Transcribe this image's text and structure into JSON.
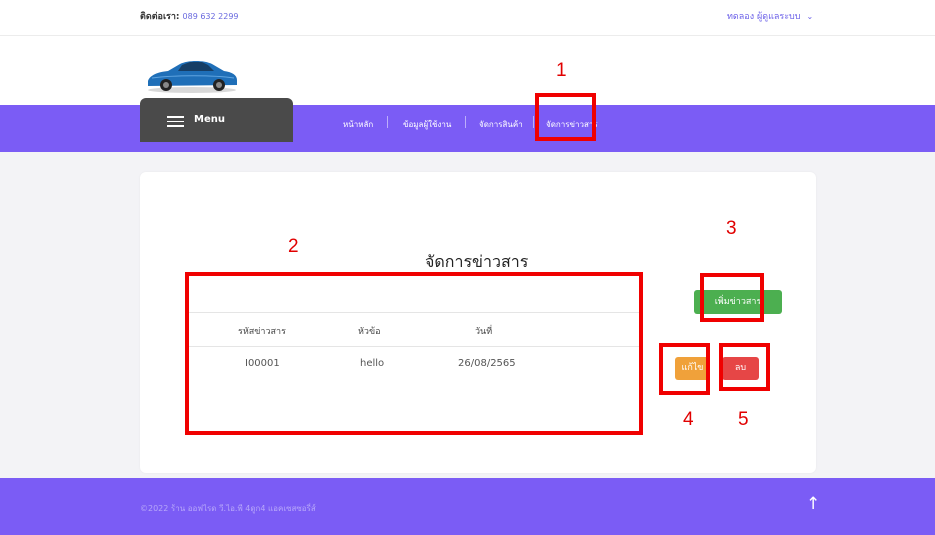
{
  "topbar": {
    "contact_label": "ติดต่อเรา:",
    "phone": "089 632 2299",
    "user_menu_label": "ทดลอง ผู้ดูแลระบบ",
    "chevron_icon": "chevron-down-icon"
  },
  "brand": {
    "logo_icon": "car-logo"
  },
  "menu": {
    "label": "Menu",
    "icon": "hamburger-icon"
  },
  "nav": {
    "items": [
      {
        "label": "หน้าหลัก"
      },
      {
        "label": "ข้อมูลผู้ใช้งาน"
      },
      {
        "label": "จัดการสินค้า"
      },
      {
        "label": "จัดการข่าวสาร"
      }
    ]
  },
  "main": {
    "title": "จัดการข่าวสาร",
    "add_button": "เพิ่มข่าวสาร",
    "table": {
      "headers": [
        "รหัสข่าวสาร",
        "หัวข้อ",
        "วันที่"
      ],
      "rows": [
        {
          "id": "I00001",
          "topic": "hello",
          "date": "26/08/2565"
        }
      ]
    },
    "edit_button": "แก้ไข",
    "delete_button": "ลบ"
  },
  "annotations": [
    "1",
    "2",
    "3",
    "4",
    "5"
  ],
  "footer": {
    "copyright": "©2022 ร้าน ออฟไรด วี.ไอ.พี 4ดูก4 แอคเซสซอรี่ส์",
    "back_to_top_icon": "arrow-up-icon"
  },
  "colors": {
    "accent": "#7b5cf5",
    "menu_bg": "#4a4a4a",
    "add": "#4caf50",
    "edit": "#f0a13a",
    "delete": "#e64646",
    "annotation": "#f00000"
  }
}
